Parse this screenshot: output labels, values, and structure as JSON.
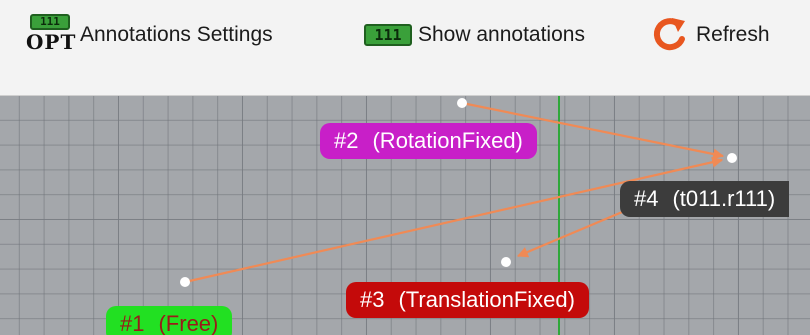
{
  "toolbar": {
    "annotations_settings": {
      "badge": "111",
      "icon_text": "OPT",
      "label": "Annotations Settings"
    },
    "show_annotations": {
      "badge": "111",
      "label": "Show annotations"
    },
    "refresh": {
      "label": "Refresh"
    }
  },
  "colors": {
    "axis_green": "#2fa83a",
    "arrow": "#f08a55"
  },
  "annotations": [
    {
      "number": "#2",
      "name": "(RotationFixed)",
      "bg": "#c81fc8",
      "fg": "#ffffff"
    },
    {
      "number": "#4",
      "name": "(t011.r111)",
      "bg": "#3c3c3c",
      "fg": "#ffffff"
    },
    {
      "number": "#3",
      "name": "(TranslationFixed)",
      "bg": "#c40a0a",
      "fg": "#ffffff"
    },
    {
      "number": "#1",
      "name": "(Free)",
      "bg": "#22e022",
      "fg": "#9b1a1a"
    }
  ]
}
